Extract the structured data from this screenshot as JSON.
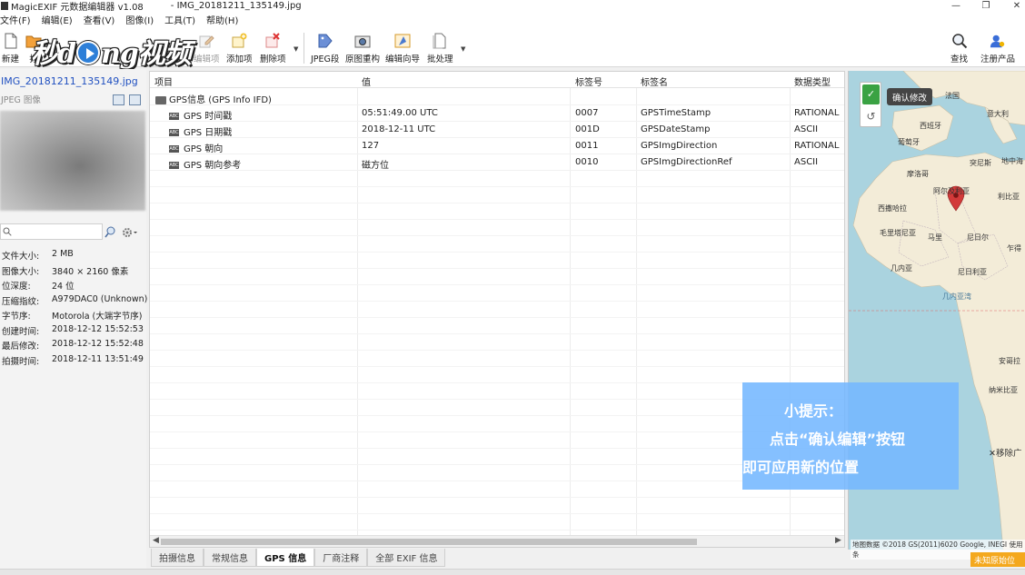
{
  "window": {
    "app_title": "MagicEXIF 元数据编辑器 v1.08",
    "file_title": "- IMG_20181211_135149.jpg",
    "controls": [
      "—",
      "❐",
      "✕"
    ]
  },
  "menu": [
    "文件(F)",
    "编辑(E)",
    "查看(V)",
    "图像(I)",
    "工具(T)",
    "帮助(H)"
  ],
  "toolbar": {
    "new": "新建",
    "open": "打",
    "edit_item": "编辑项",
    "add_item": "添加项",
    "delete_item": "删除项",
    "jpeg_segment": "JPEG段",
    "rebuild": "原图重构",
    "wizard": "编辑向导",
    "batch": "批处理",
    "search": "查找",
    "register": "注册产品"
  },
  "watermark": {
    "part1": "秒d",
    "part2": "ng视频"
  },
  "left_panel": {
    "filename": "IMG_20181211_135149.jpg",
    "filetype": "JPEG 图像",
    "properties": [
      {
        "key": "文件大小:",
        "value": "2 MB"
      },
      {
        "key": "图像大小:",
        "value": "3840 × 2160 像素"
      },
      {
        "key": "位深度:",
        "value": "24 位"
      },
      {
        "key": "压缩指纹:",
        "value": "A979DAC0 (Unknown)"
      },
      {
        "key": "字节序:",
        "value": "Motorola (大端字节序)"
      },
      {
        "key": "创建时间:",
        "value": "2018-12-12 15:52:53"
      },
      {
        "key": "最后修改:",
        "value": "2018-12-12 15:52:48"
      },
      {
        "key": "拍摄时间:",
        "value": "2018-12-11 13:51:49"
      }
    ]
  },
  "grid": {
    "headers": [
      "项目",
      "值",
      "标签号",
      "标签名",
      "数据类型"
    ],
    "group": "GPS信息 (GPS Info IFD)",
    "rows": [
      {
        "badge": "ABC",
        "name": "GPS 时间戳",
        "value": "05:51:49.00 UTC",
        "tag_no": "0007",
        "tag_name": "GPSTimeStamp",
        "type": "RATIONAL"
      },
      {
        "badge": "ABC",
        "name": "GPS 日期戳",
        "value": "2018-12-11 UTC",
        "tag_no": "001D",
        "tag_name": "GPSDateStamp",
        "type": "ASCII"
      },
      {
        "badge": "ABC",
        "name": "GPS 朝向",
        "value": "127",
        "tag_no": "0011",
        "tag_name": "GPSImgDirection",
        "type": "RATIONAL"
      },
      {
        "badge": "ABC",
        "name": "GPS 朝向参考",
        "value": "磁方位",
        "tag_no": "0010",
        "tag_name": "GPSImgDirectionRef",
        "type": "ASCII"
      }
    ]
  },
  "tabs": [
    "拍摄信息",
    "常规信息",
    "GPS 信息",
    "厂商注释",
    "全部 EXIF 信息"
  ],
  "active_tab": "GPS 信息",
  "map": {
    "confirm_tooltip": "确认修改",
    "remove_ad": "✕移除广",
    "footer": "地图数据 ©2018 GS(2011)6020 Google, INEGI 使用条",
    "unknown_badge": "未知原始位",
    "labels": [
      "法国",
      "意大利",
      "西班牙",
      "葡萄牙",
      "地中海",
      "突尼斯",
      "摩洛哥",
      "阿尔及利亚",
      "利比亚",
      "西撒哈拉",
      "毛里塔尼亚",
      "马里",
      "尼日尔",
      "乍得",
      "几内亚",
      "尼日利亚",
      "几内亚湾",
      "安哥拉",
      "纳米比亚"
    ]
  },
  "hint": {
    "title": "小提示：",
    "line1": "点击“确认编辑”按钮",
    "line2": "即可应用新的位置"
  },
  "colors": {
    "accent_blue": "#2050c0",
    "confirm_green": "#3aa243",
    "hint_bg": "#74b7ff",
    "map_water": "#aad3df",
    "map_land": "#f3ecd8",
    "pin": "#d23a3a"
  }
}
